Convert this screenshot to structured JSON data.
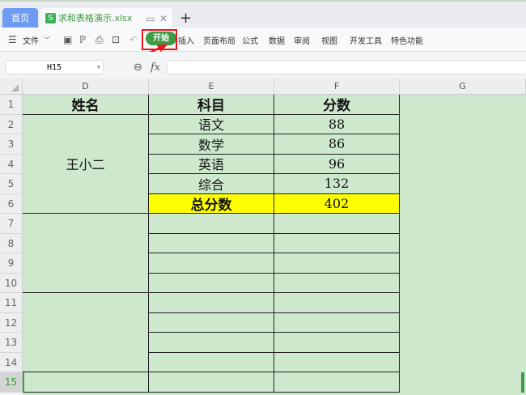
{
  "tabs": {
    "home": "首页",
    "file": "求和表格演示.xlsx",
    "new_tab": "+"
  },
  "ribbon": {
    "file_menu": "文件",
    "start": "开始",
    "items": [
      "插入",
      "页面布局",
      "公式",
      "数据",
      "审阅",
      "视图",
      "开发工具",
      "特色功能"
    ]
  },
  "formula_bar": {
    "name_box": "H15",
    "fx": "fx",
    "value": ""
  },
  "columns": [
    "D",
    "E",
    "F",
    "G"
  ],
  "rows": [
    "1",
    "2",
    "3",
    "4",
    "5",
    "6",
    "7",
    "8",
    "9",
    "10",
    "11",
    "12",
    "13",
    "14",
    "15"
  ],
  "selected_row": "15",
  "sheet": {
    "headers": {
      "name": "姓名",
      "subject": "科目",
      "score": "分数"
    },
    "student": "王小二",
    "records": [
      {
        "subject": "语文",
        "score": "88"
      },
      {
        "subject": "数学",
        "score": "86"
      },
      {
        "subject": "英语",
        "score": "96"
      },
      {
        "subject": "综合",
        "score": "132"
      }
    ],
    "total": {
      "label": "总分数",
      "value": "402"
    }
  },
  "colors": {
    "cell_bg": "#cde8cd",
    "total_bg": "#ffff00",
    "accent": "#3f9b46",
    "highlight": "#e8141b"
  }
}
